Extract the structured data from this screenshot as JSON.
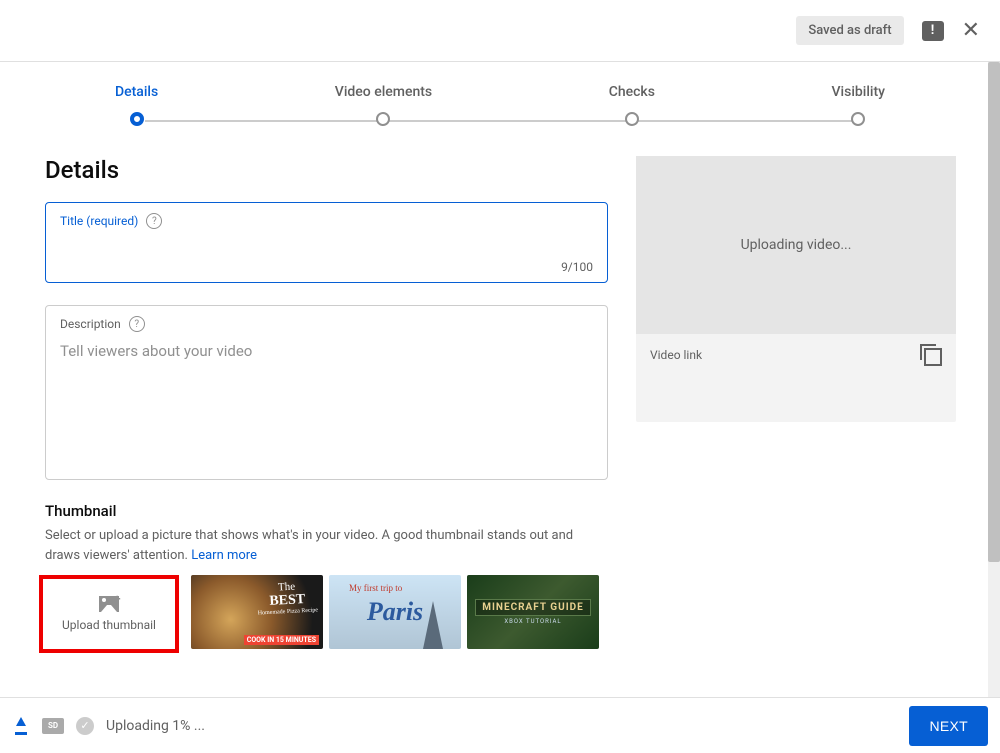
{
  "header": {
    "draft_badge": "Saved as draft"
  },
  "stepper": {
    "steps": [
      "Details",
      "Video elements",
      "Checks",
      "Visibility"
    ],
    "active_index": 0
  },
  "details": {
    "section_title": "Details",
    "title_field": {
      "label": "Title (required)",
      "value": "",
      "counter": "9/100"
    },
    "description_field": {
      "label": "Description",
      "placeholder": "Tell viewers about your video",
      "value": ""
    },
    "thumbnail": {
      "heading": "Thumbnail",
      "description": "Select or upload a picture that shows what's in your video. A good thumbnail stands out and draws viewers' attention. ",
      "learn_more": "Learn more",
      "upload_label": "Upload thumbnail",
      "preview1": {
        "title_line1": "The",
        "title_line2": "BEST",
        "sub": "Homemade Pizza Recipe",
        "badge": "COOK IN 15 MINUTES"
      },
      "preview2": {
        "sub": "My first trip to",
        "main": "Paris"
      },
      "preview3": {
        "title": "MINECRAFT GUIDE",
        "sub": "XBOX TUTORIAL"
      }
    }
  },
  "video_panel": {
    "status": "Uploading video...",
    "link_label": "Video link"
  },
  "footer": {
    "sd_label": "SD",
    "status_text": "Uploading 1% ...",
    "next_label": "NEXT"
  }
}
